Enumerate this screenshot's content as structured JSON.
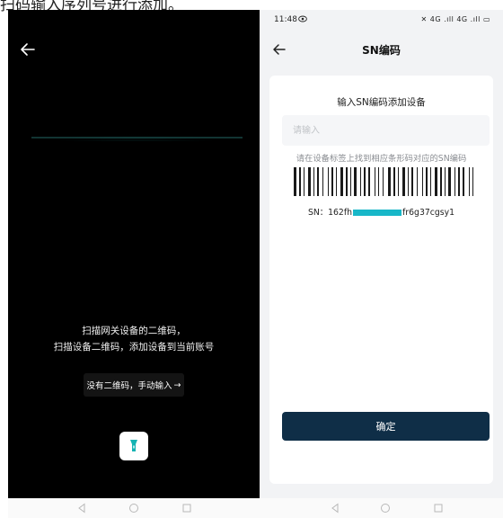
{
  "caption": "扫码输入序列号进行添加。",
  "left": {
    "scan_line1": "扫描网关设备的二维码，",
    "scan_line2": "扫描设备二维码，添加设备到当前账号",
    "manual_label": "没有二维码，手动输入",
    "manual_arrow": "→",
    "icons": [
      "back-arrow-icon",
      "flashlight-icon"
    ]
  },
  "right": {
    "status": {
      "time": "11:48",
      "signal": "4G .ıll 4G .ıll"
    },
    "title": "SN编码",
    "card_title": "输入SN编码添加设备",
    "input": {
      "value": "",
      "placeholder": "请输入"
    },
    "hint": "请在设备标签上找到相应条形码对应的SN编码",
    "sn_prefix": "SN：162fh",
    "sn_suffix": "fr6g37cgsy1",
    "confirm_label": "确定"
  },
  "colors": {
    "accent": "#0f2e47",
    "mask": "#18b7c8",
    "glow": "#1fc9c0"
  }
}
